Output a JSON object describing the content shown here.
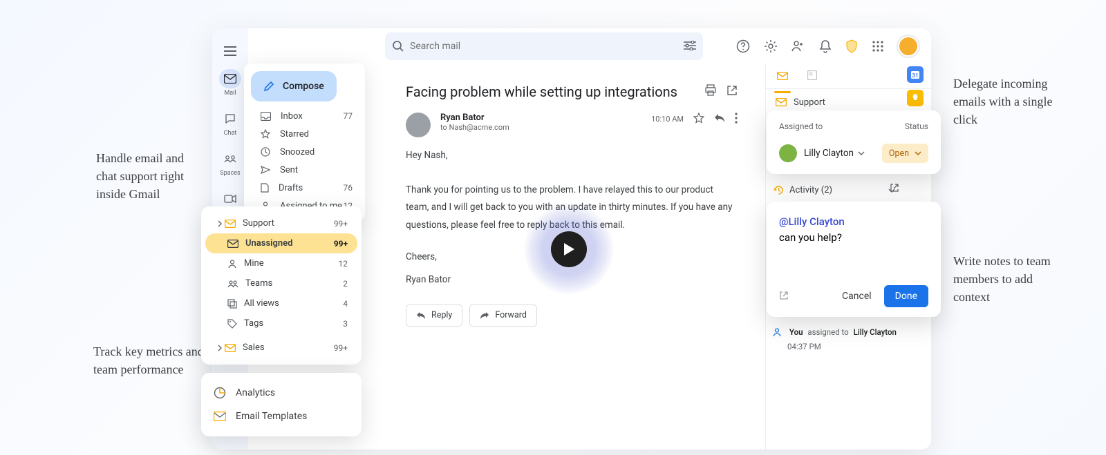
{
  "annotations": {
    "left_top": "Handle email and chat support right inside Gmail",
    "left_bottom": "Track key metrics and team performance",
    "right_top": "Delegate incoming emails with a single click",
    "right_bottom": "Write notes to team members to add context"
  },
  "search": {
    "placeholder": "Search mail"
  },
  "rail": {
    "mail": "Mail",
    "chat": "Chat",
    "spaces": "Spaces",
    "meet": "Meet"
  },
  "sidebar": {
    "compose": "Compose",
    "items": [
      {
        "label": "Inbox",
        "count": "77"
      },
      {
        "label": "Starred",
        "count": ""
      },
      {
        "label": "Snoozed",
        "count": ""
      },
      {
        "label": "Sent",
        "count": ""
      },
      {
        "label": "Drafts",
        "count": "76"
      },
      {
        "label": "Assigned to me",
        "count": "12"
      }
    ]
  },
  "groups": {
    "support": {
      "label": "Support",
      "count": "99+"
    },
    "unassigned": {
      "label": "Unassigned",
      "count": "99+"
    },
    "mine": {
      "label": "Mine",
      "count": "12"
    },
    "teams": {
      "label": "Teams",
      "count": "2"
    },
    "allviews": {
      "label": "All views",
      "count": "4"
    },
    "tags": {
      "label": "Tags",
      "count": "3"
    },
    "sales": {
      "label": "Sales",
      "count": "99+"
    }
  },
  "tools": {
    "analytics": "Analytics",
    "templates": "Email Templates"
  },
  "mail": {
    "subject": "Facing problem while setting up integrations",
    "sender": "Ryan Bator",
    "to": "to Nash@acme.com",
    "time": "10:10 AM",
    "greeting": "Hey Nash,",
    "para": "Thank you for pointing us to the problem. I have relayed this to our product team, and I will get back to you with an update in thirty minutes. If you have any questions, please feel free to reply back to this email.",
    "sign1": "Cheers,",
    "sign2": "Ryan Bator",
    "reply": "Reply",
    "forward": "Forward"
  },
  "right_panel": {
    "section_support": "Support",
    "activity": "Activity (2)"
  },
  "assign": {
    "h_assigned": "Assigned to",
    "h_status": "Status",
    "name": "Lilly Clayton",
    "status": "Open"
  },
  "note": {
    "mention": "@Lilly Clayton",
    "body": "can you help?",
    "cancel": "Cancel",
    "done": "Done"
  },
  "activity_item": {
    "you": "You",
    "action": "assigned to",
    "name": "Lilly Clayton",
    "time": "04:37 PM"
  }
}
